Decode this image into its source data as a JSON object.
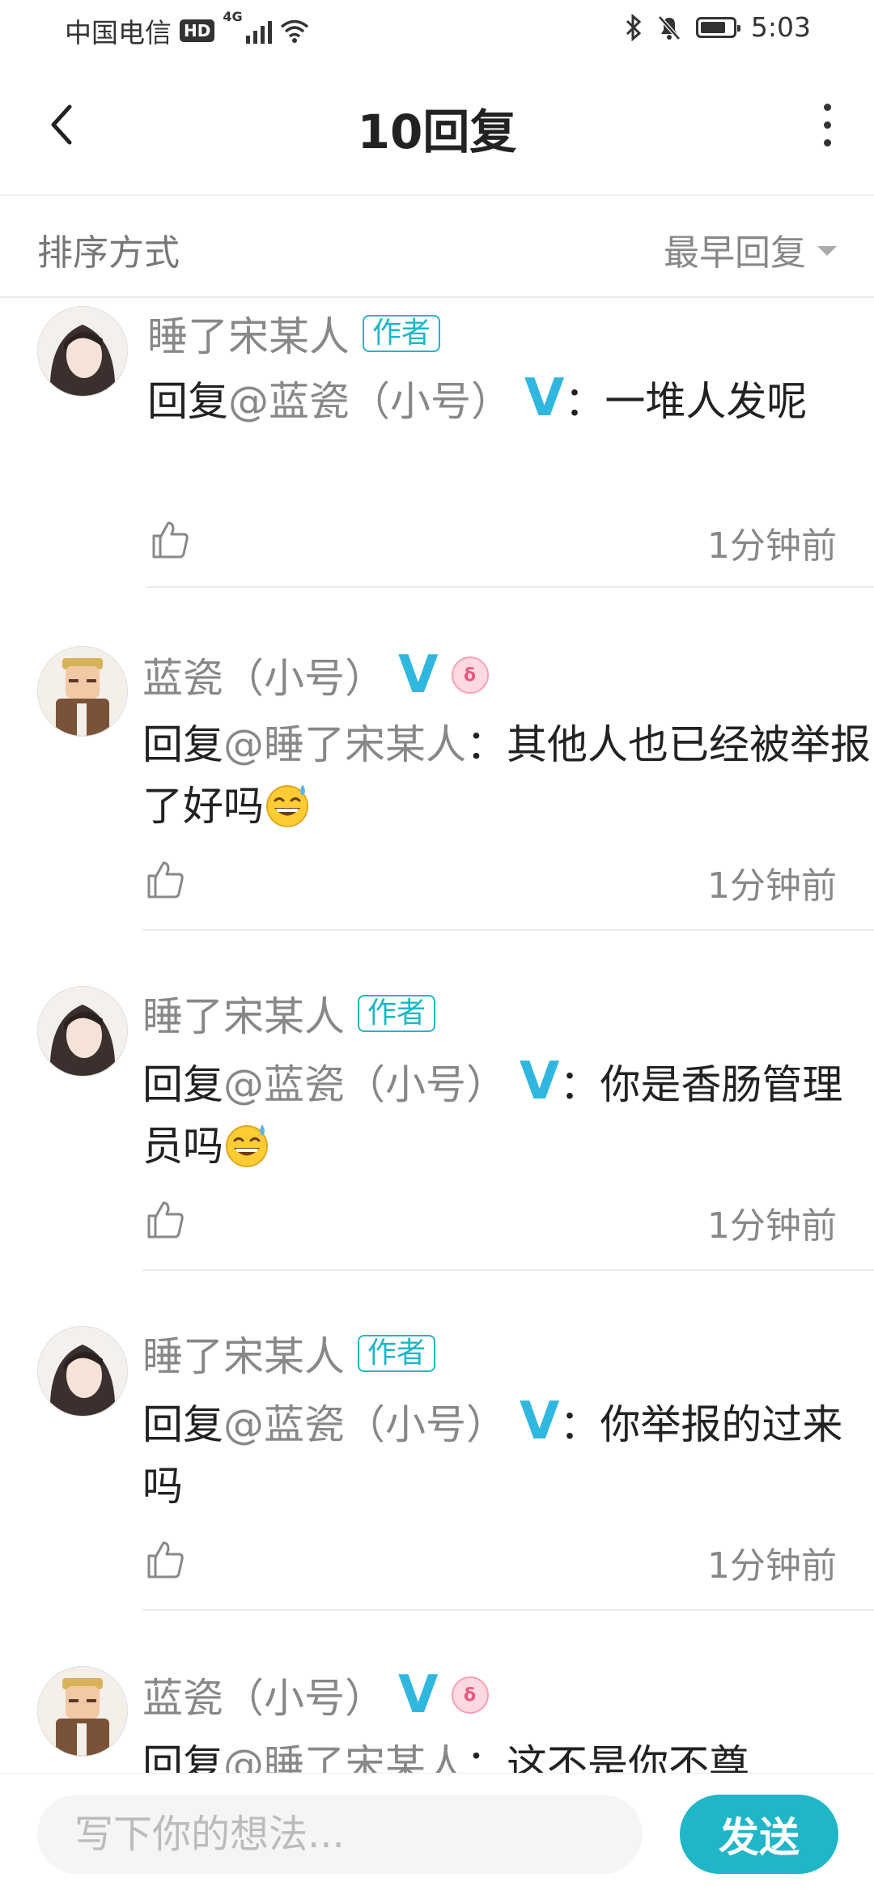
{
  "status_bar": {
    "carrier": "中国电信",
    "hd": "HD",
    "network": "4G",
    "time": "5:03",
    "battery_level": 0.8
  },
  "header": {
    "title": "10回复",
    "back_icon": "chevron-left-icon",
    "more_icon": "more-vertical-icon"
  },
  "sort": {
    "label": "排序方式",
    "value": "最早回复"
  },
  "replies": [
    {
      "name": "睡了宋某人",
      "tag": "作者",
      "prefix": "回复",
      "mention": "@蓝瓷（小号）",
      "verified": "V",
      "text": "：一堆人发呢",
      "time": "1分钟前"
    },
    {
      "name": "蓝瓷（小号）",
      "verified": "V",
      "prefix": "回复",
      "mention": "@睡了宋某人",
      "text": "：其他人也已经被举报了好吗",
      "emoji": "sweat-smile-emoji",
      "time": "1分钟前"
    },
    {
      "name": "睡了宋某人",
      "tag": "作者",
      "prefix": "回复",
      "mention": "@蓝瓷（小号）",
      "verified": "V",
      "text": "：你是香肠管理员吗",
      "emoji": "sweat-smile-emoji",
      "time": "1分钟前"
    },
    {
      "name": "睡了宋某人",
      "tag": "作者",
      "prefix": "回复",
      "mention": "@蓝瓷（小号）",
      "verified": "V",
      "text": "：你举报的过来吗",
      "time": "1分钟前"
    },
    {
      "name": "蓝瓷（小号）",
      "verified": "V",
      "prefix": "回复",
      "mention": "@睡了宋某人",
      "text": "：这不是你不尊"
    }
  ],
  "composer": {
    "placeholder": "写下你的想法...",
    "send_label": "发送"
  },
  "colors": {
    "accent": "#1fb6c8",
    "verified": "#30b7e0",
    "muted_text": "#888888"
  }
}
